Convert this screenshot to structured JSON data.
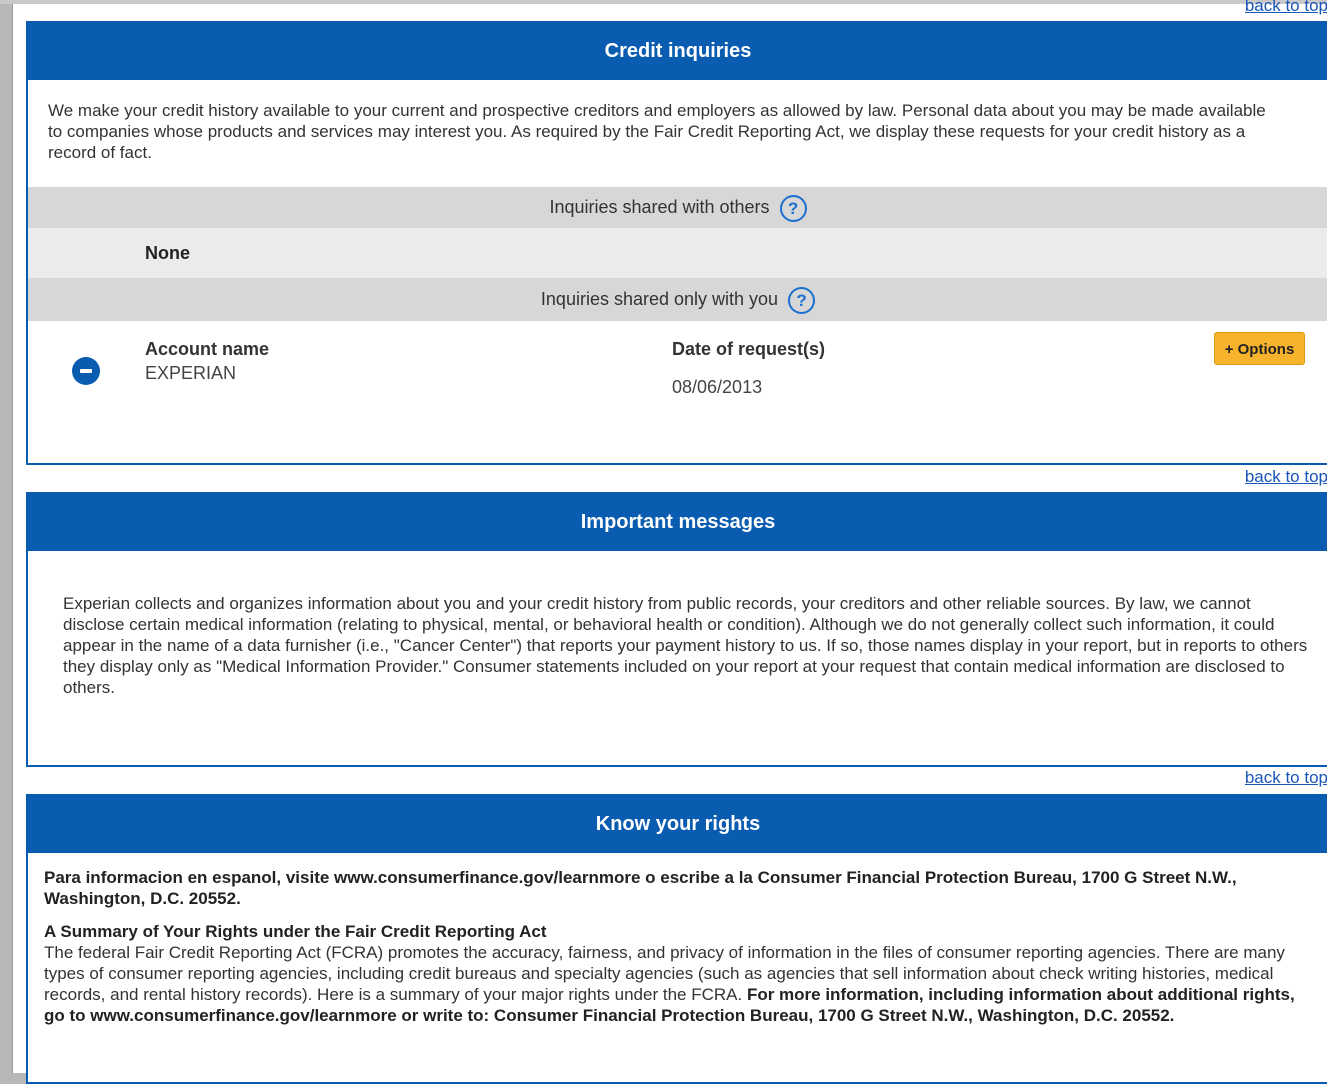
{
  "back_to_top": "back to top",
  "credit_inquiries": {
    "title": "Credit inquiries",
    "intro": "We make your credit history available to your current and prospective creditors and employers as allowed by law. Personal data about you may be made available to companies whose products and services may interest you. As required by the Fair Credit Reporting Act, we display these requests for your credit history as a record of fact.",
    "shared_with_others": {
      "label": "Inquiries shared with others",
      "help_icon": "?",
      "value": "None"
    },
    "shared_with_you": {
      "label": "Inquiries shared only with you",
      "help_icon": "?",
      "account_label": "Account name",
      "account_value": "EXPERIAN",
      "date_label": "Date of request(s)",
      "date_value": "08/06/2013",
      "options_button": "+ Options"
    }
  },
  "important_messages": {
    "title": "Important messages",
    "body": "Experian collects and organizes information about you and your credit history from public records, your creditors and other reliable sources. By law, we cannot disclose certain medical information (relating to physical, mental, or behavioral health or condition). Although we do not generally collect such information, it could appear in the name of a data furnisher (i.e., \"Cancer Center\") that reports your payment history to us. If so, those names display in your report, but in reports to others they display only as \"Medical Information Provider.\" Consumer statements included on your report at your request that contain medical information are disclosed to others."
  },
  "know_your_rights": {
    "title": "Know your rights",
    "spanish_notice": "Para informacion en espanol, visite www.consumerfinance.gov/learnmore o escribe a la Consumer Financial Protection Bureau, 1700 G Street N.W., Washington, D.C. 20552.",
    "summary_heading": "A Summary of Your Rights under the Fair Credit Reporting Act",
    "summary_body": "The federal Fair Credit Reporting Act (FCRA) promotes the accuracy, fairness, and privacy of information in the files of consumer reporting agencies. There are many types of consumer reporting agencies, including credit bureaus and specialty agencies (such as agencies that sell information about check writing histories, medical records, and rental history records). Here is a summary of your major rights under the FCRA.",
    "summary_more": "For more information, including information about additional rights, go to www.consumerfinance.gov/learnmore or write to: Consumer Financial Protection Bureau, 1700 G Street N.W., Washington, D.C. 20552."
  }
}
